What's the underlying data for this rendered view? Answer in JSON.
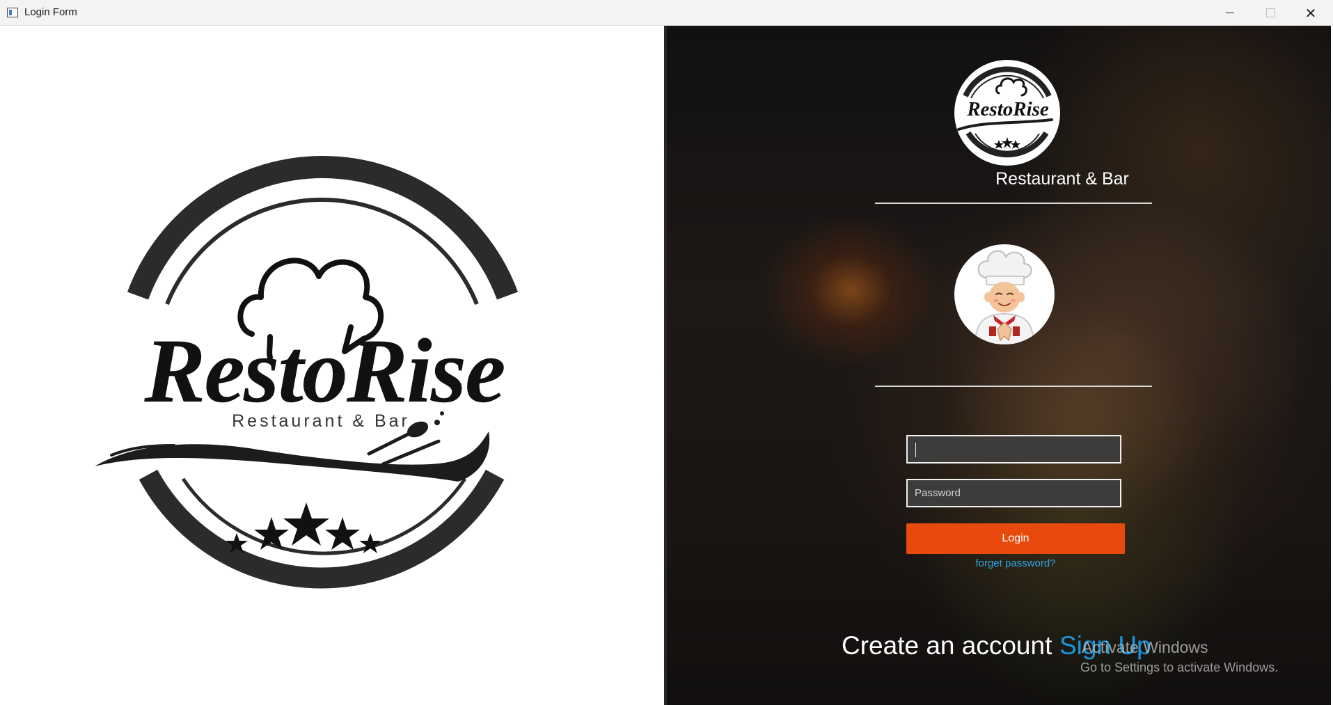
{
  "window": {
    "title": "Login Form",
    "controls": {
      "minimize": "minimize",
      "maximize": "maximize",
      "close": "close"
    }
  },
  "brand": {
    "name": "RestoRise",
    "name_left": "Resto",
    "name_right": "Rise",
    "tagline": "Restaurant & Bar",
    "subtitle": "Restaurant & Bar",
    "stars": 5
  },
  "form": {
    "username_value": "",
    "username_placeholder": "",
    "password_placeholder": "Password",
    "login_label": "Login",
    "forgot_label": "forget password?",
    "create_account_text": "Create an account",
    "signup_label": "Sign Up"
  },
  "watermark": {
    "title": "Activate Windows",
    "subtitle": "Go to Settings to activate Windows."
  },
  "colors": {
    "accent": "#e84a0e",
    "link": "#2ba3e0",
    "signup": "#1796de"
  }
}
